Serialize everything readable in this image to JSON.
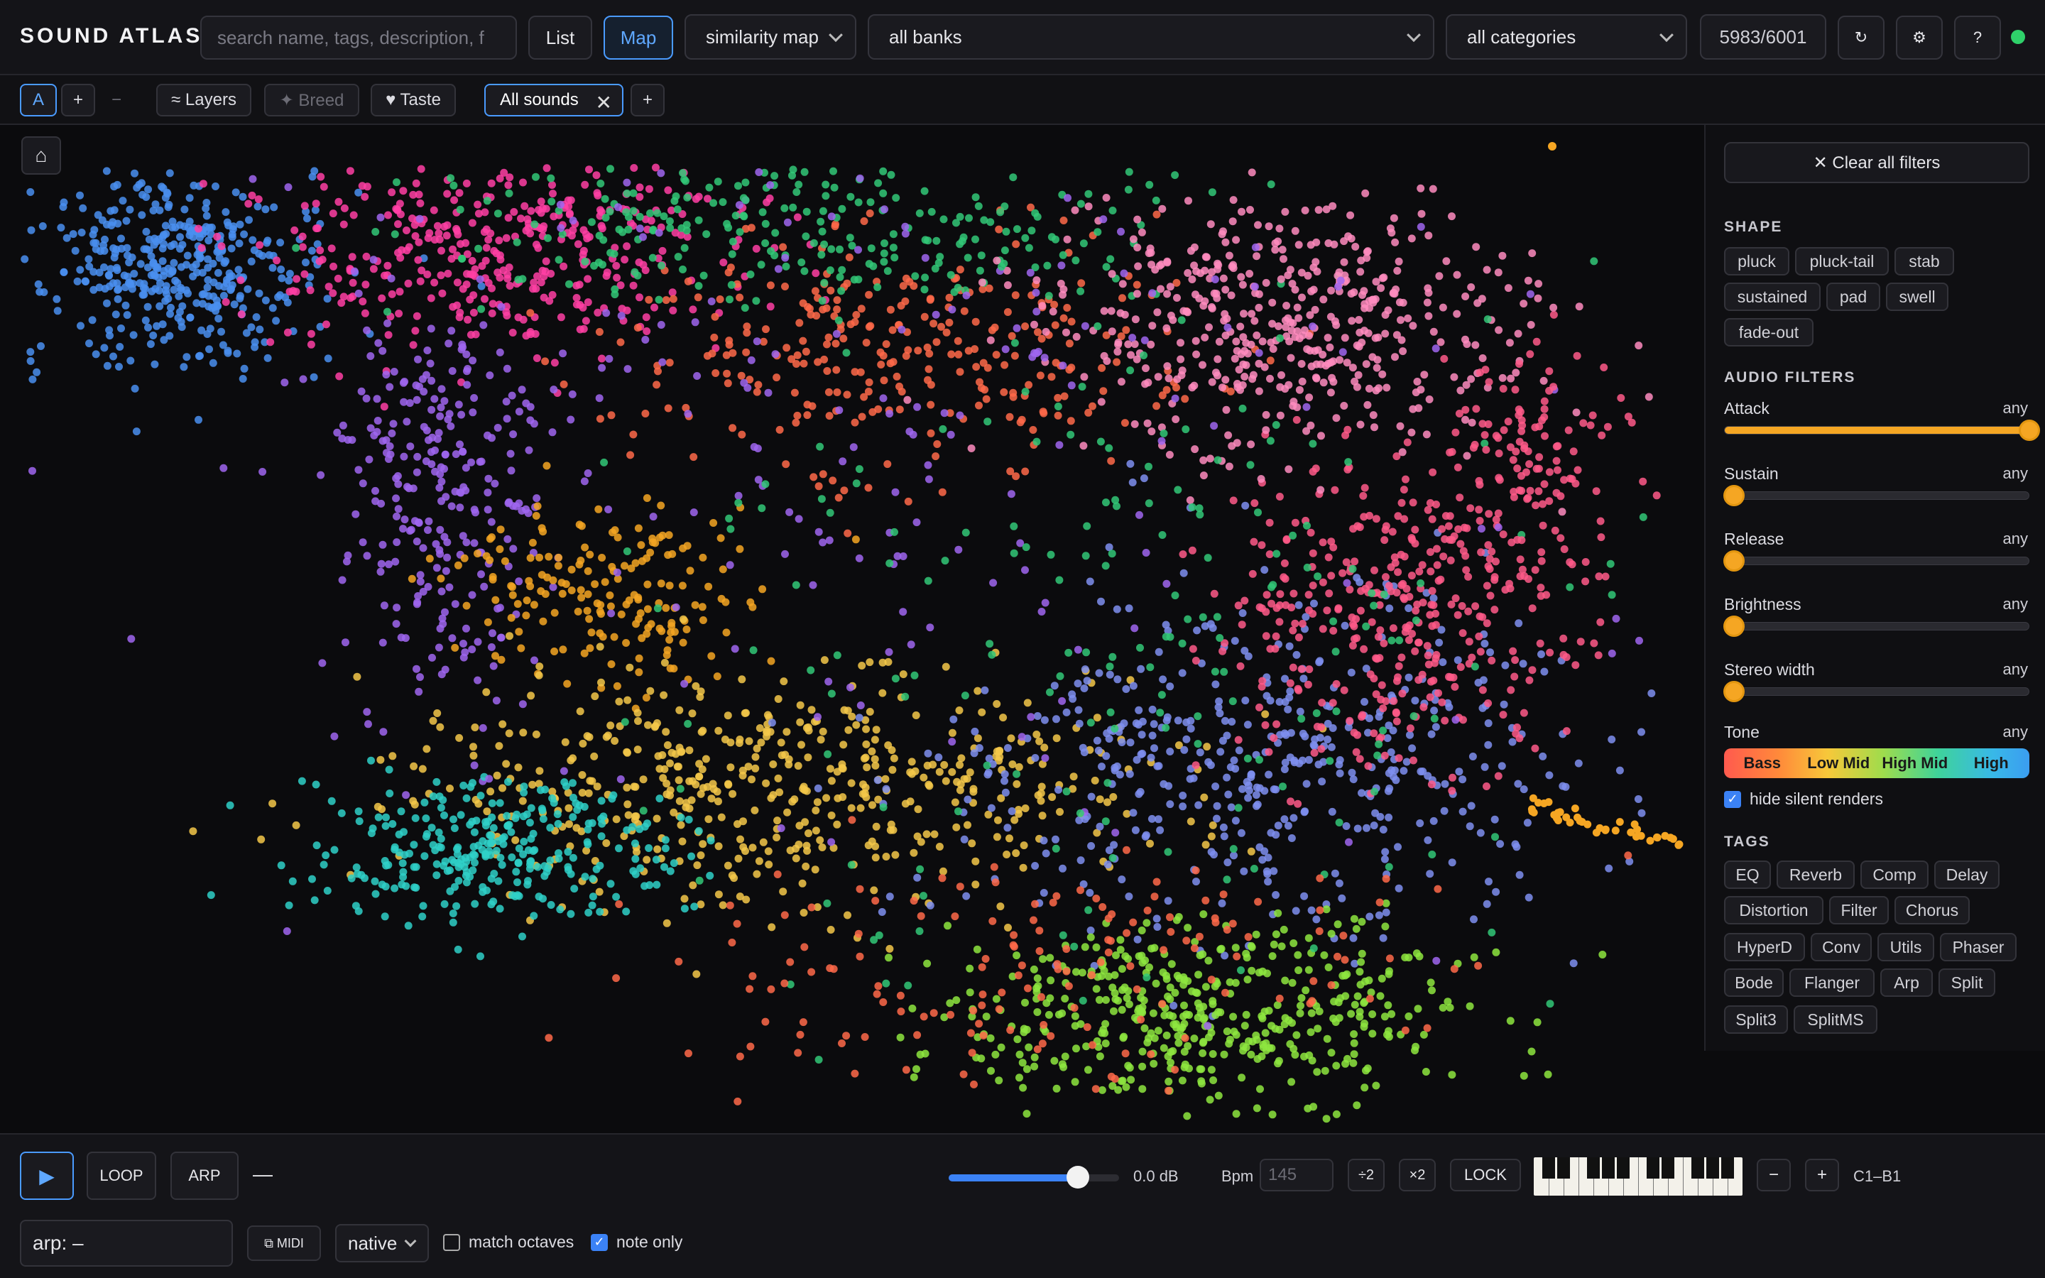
{
  "app": {
    "title": "SOUND ATLAS"
  },
  "header": {
    "search_placeholder": "search name, tags, description, f",
    "view_list": "List",
    "view_map": "Map",
    "map_mode": "similarity map",
    "bank_filter": "all banks",
    "category_filter": "all categories",
    "count": "5983/6001",
    "refresh_icon": "↻",
    "settings_icon": "⚙",
    "help_icon": "?",
    "status_color": "#2fd16a"
  },
  "toolbar": {
    "a_label": "A",
    "plus": "+",
    "minus": "−",
    "layers": "≈ Layers",
    "breed": "✦ Breed",
    "taste": "♥ Taste",
    "tab_all_sounds": "All sounds",
    "tab_close": "✕",
    "add_tab": "+"
  },
  "map": {
    "home_icon": "⌂"
  },
  "panel": {
    "clear_filters": "✕ Clear all filters",
    "shape_title": "SHAPE",
    "shapes": [
      "pluck",
      "pluck-tail",
      "stab",
      "sustained",
      "pad",
      "swell",
      "fade-out"
    ],
    "audio_title": "AUDIO FILTERS",
    "filters": [
      {
        "label": "Attack",
        "value": "any",
        "level": 1.0
      },
      {
        "label": "Sustain",
        "value": "any",
        "level": 0.0
      },
      {
        "label": "Release",
        "value": "any",
        "level": 0.0
      },
      {
        "label": "Brightness",
        "value": "any",
        "level": 0.0
      },
      {
        "label": "Stereo width",
        "value": "any",
        "level": 0.0
      }
    ],
    "tone_label": "Tone",
    "tone_value": "any",
    "tone_bands": [
      "Bass",
      "Low Mid",
      "High Mid",
      "High"
    ],
    "hide_silent": "hide silent renders",
    "tags_title": "TAGS",
    "tags": [
      "EQ",
      "Reverb",
      "Comp",
      "Delay",
      "Distortion",
      "Filter",
      "Chorus",
      "HyperD",
      "Conv",
      "Utils",
      "Phaser",
      "Bode",
      "Flanger",
      "Arp",
      "Split",
      "Split3",
      "SplitMS"
    ]
  },
  "bottom": {
    "play_icon": "▶",
    "loop": "LOOP",
    "arp": "ARP",
    "arp_dash": "—",
    "volume_db": "0.0 dB",
    "bpm_label": "Bpm",
    "bpm_value": "145",
    "div2": "÷2",
    "mul2": "×2",
    "lock": "LOCK",
    "oct_minus": "−",
    "oct_plus": "+",
    "range": "C1–B1",
    "arp_field": "arp: –",
    "midi": "⧉ MIDI",
    "tuning": "native",
    "match_octaves": "match octaves",
    "note_only": "note only"
  },
  "cluster_colors": [
    "#4a8ff0",
    "#ff3fa4",
    "#a066f0",
    "#ff6a4a",
    "#f5a623",
    "#f5c84a",
    "#2fd0c8",
    "#32c878",
    "#7f8ff0",
    "#ff5a8a",
    "#ff8cc0",
    "#8ee63f"
  ]
}
